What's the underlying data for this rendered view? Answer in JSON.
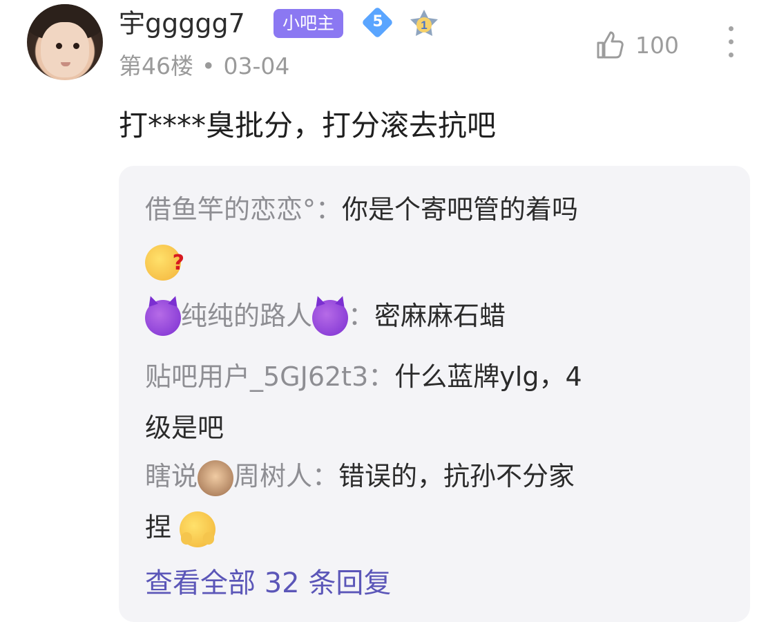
{
  "post": {
    "username": "宇ggggg7",
    "admin_badge": "小吧主",
    "level_number": "5",
    "rank_number": "1",
    "floor_label": "第46楼",
    "dot": "•",
    "date": "03-04",
    "like_count": "100",
    "content": "打****臭批分，打分滚去抗吧"
  },
  "icons": {
    "avatar": "avatar-child-photo",
    "like": "thumb-up-icon",
    "more": "more-vertical-icon",
    "level": "diamond-level-icon",
    "rank": "rank-one-icon",
    "thinking": "thinking-face-emoji",
    "devil": "smiling-devil-emoji",
    "monkey": "see-no-evil-monkey-emoji",
    "hug": "hugging-face-emoji"
  },
  "colors": {
    "admin_badge": "#8b78f2",
    "level_badge": "#5aa5ff",
    "view_all": "#5b56b8",
    "reply_bg": "#f4f4f7",
    "meta_text": "#9a9a9a"
  },
  "replies": [
    {
      "author": "借鱼竿的恋恋°",
      "colon": "：",
      "text": "你是个寄吧管的着吗"
    },
    {
      "author": "纯纯的路人",
      "colon": "：",
      "text": "密麻麻石蜡"
    },
    {
      "author": "贴吧用户_5GJ62t3",
      "colon": "：",
      "text_line1": "什么蓝牌ylg，4",
      "text_line2": "级是吧"
    },
    {
      "author_prefix": "瞎说",
      "author_suffix": "周树人",
      "colon": "：",
      "text_line1": "错误的，抗孙不分家",
      "text_line2": "捏"
    }
  ],
  "view_all": "查看全部 32 条回复"
}
